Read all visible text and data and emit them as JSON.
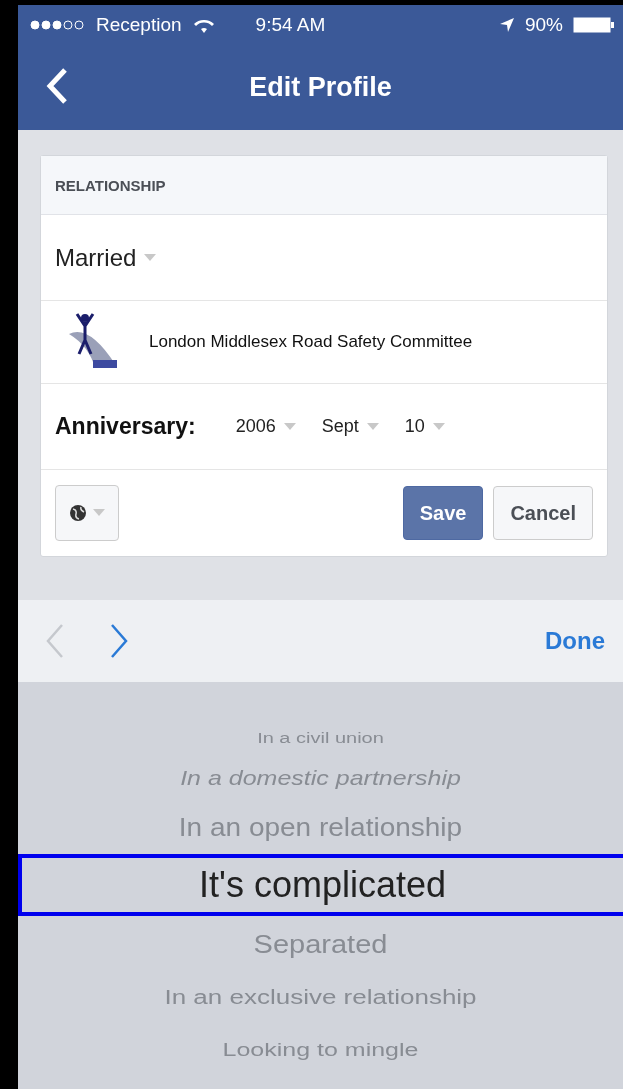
{
  "status_bar": {
    "carrier": "Reception",
    "time": "9:54 AM",
    "battery": "90%"
  },
  "nav": {
    "title": "Edit Profile"
  },
  "card": {
    "header": "RELATIONSHIP",
    "status": "Married",
    "partner": "London Middlesex Road Safety Committee",
    "anniversary": {
      "label": "Anniversary:",
      "year": "2006",
      "month": "Sept",
      "day": "10"
    },
    "save": "Save",
    "cancel": "Cancel"
  },
  "toolbar": {
    "prev_disabled": true,
    "next_disabled": false,
    "done": "Done"
  },
  "picker": [
    {
      "label": "In a civil union",
      "selected": false
    },
    {
      "label": "In a domestic partnership",
      "selected": false
    },
    {
      "label": "In an open relationship",
      "selected": false
    },
    {
      "label": "It's complicated",
      "selected": true
    },
    {
      "label": "Separated",
      "selected": false
    },
    {
      "label": "In an exclusive relationship",
      "selected": false
    },
    {
      "label": "Looking to mingle",
      "selected": false
    }
  ]
}
